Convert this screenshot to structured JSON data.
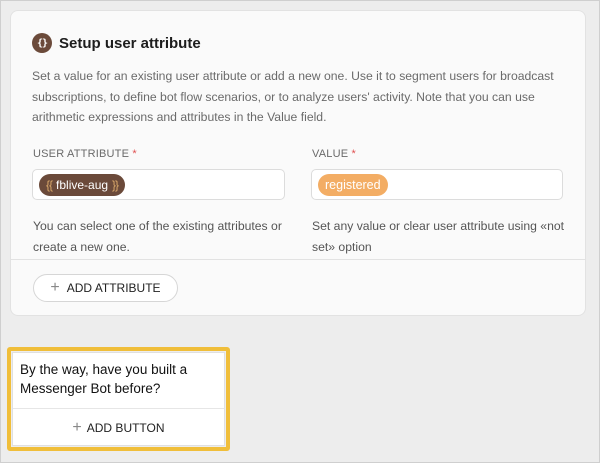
{
  "card": {
    "icon": "curly-braces-icon",
    "icon_glyph": "{}",
    "title": "Setup user attribute",
    "description": "Set a value for an existing user attribute or add a new one. Use it to segment users for broadcast subscriptions, to define bot flow scenarios, or to analyze users' activity. Note that you can use arithmetic expressions and attributes in the Value field."
  },
  "user_attribute": {
    "label": "USER ATTRIBUTE",
    "required_mark": "*",
    "value": "fblive-aug",
    "brace_open": "{{",
    "brace_close": "}}",
    "hint": "You can select one of the existing attributes or create a new one."
  },
  "value_field": {
    "label": "VALUE",
    "required_mark": "*",
    "value": "registered",
    "hint": "Set any value or clear user attribute using «not set» option"
  },
  "add_attribute": {
    "icon": "plus-icon",
    "label": "ADD ATTRIBUTE"
  },
  "bot_message": {
    "text": "By the way, have you built a Messenger Bot before?",
    "add_button": {
      "icon": "plus-icon",
      "label": "ADD BUTTON"
    }
  },
  "colors": {
    "attribute_chip": "#6b4a3a",
    "value_chip": "#f3ad64",
    "highlight": "#f0be3a",
    "required": "#e05050"
  }
}
